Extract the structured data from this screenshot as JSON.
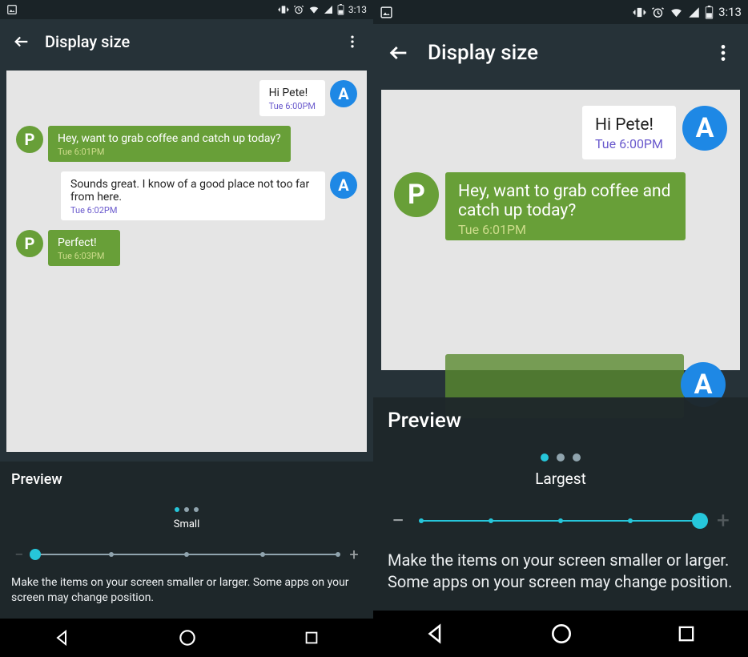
{
  "status": {
    "time": "3:13"
  },
  "appbar": {
    "title": "Display size"
  },
  "panel": {
    "preview_label": "Preview",
    "description": "Make the items on your screen smaller or larger. Some apps on your screen may change position."
  },
  "slider": {
    "steps": 5,
    "left": {
      "index": 0,
      "label": "Small"
    },
    "right": {
      "index": 4,
      "label": "Largest"
    }
  },
  "messages": [
    {
      "side": "right",
      "avatar": "A",
      "text": "Hi Pete!",
      "time": "Tue 6:00PM"
    },
    {
      "side": "left",
      "avatar": "P",
      "text": "Hey, want to grab coffee and catch up today?",
      "time": "Tue 6:01PM"
    },
    {
      "side": "right",
      "avatar": "A",
      "text": "Sounds great. I know of a good place not too far from here.",
      "time": "Tue 6:02PM"
    },
    {
      "side": "left",
      "avatar": "P",
      "text": "Perfect!",
      "time": "Tue 6:03PM"
    }
  ]
}
